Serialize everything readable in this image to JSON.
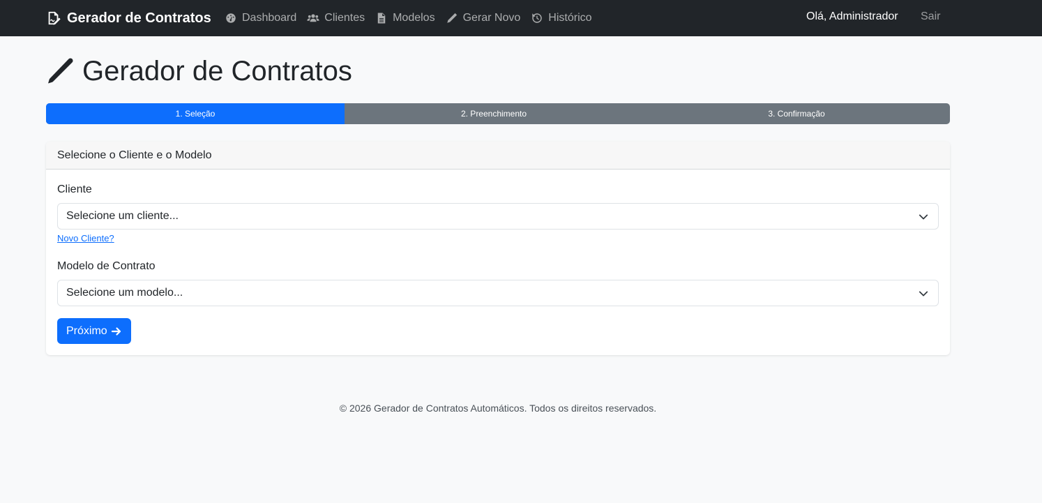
{
  "navbar": {
    "brand": "Gerador de Contratos",
    "links": [
      {
        "label": "Dashboard",
        "icon": "dashboard-icon"
      },
      {
        "label": "Clientes",
        "icon": "users-icon"
      },
      {
        "label": "Modelos",
        "icon": "file-icon"
      },
      {
        "label": "Gerar Novo",
        "icon": "pen-icon"
      },
      {
        "label": "Histórico",
        "icon": "history-icon"
      }
    ],
    "greeting": "Olá, Administrador",
    "logout": "Sair"
  },
  "page": {
    "title": "Gerador de Contratos"
  },
  "progress": {
    "steps": [
      {
        "label": "1. Seleção",
        "active": true
      },
      {
        "label": "2. Preenchimento",
        "active": false
      },
      {
        "label": "3. Confirmação",
        "active": false
      }
    ]
  },
  "form": {
    "header": "Selecione o Cliente e o Modelo",
    "client_label": "Cliente",
    "client_value": "Selecione um cliente...",
    "new_client_link": "Novo Cliente?",
    "model_label": "Modelo de Contrato",
    "model_value": "Selecione um modelo...",
    "next_button": "Próximo"
  },
  "footer": {
    "text": "© 2026 Gerador de Contratos Automáticos. Todos os direitos reservados."
  },
  "colors": {
    "navbar": "#212529",
    "primary": "#0d6efd",
    "secondary": "#6c757d",
    "background": "#f8f9fa"
  }
}
